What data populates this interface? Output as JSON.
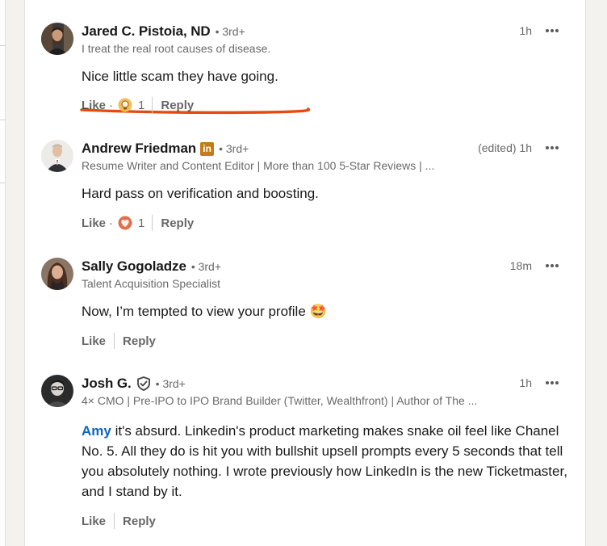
{
  "colors": {
    "accent": "#0a66c2",
    "underline": "#e8490f",
    "linkedin_badge": "#c37d16",
    "meta_text": "#666666"
  },
  "comments": [
    {
      "name": "Jared C. Pistoia, ND",
      "degree": "• 3rd+",
      "headline": "I treat the real root causes of disease.",
      "time": "1h",
      "text": "Nice little scam they have going.",
      "like_label": "Like",
      "reaction_separator": "·",
      "reaction_icon": "insightful-lightbulb-icon",
      "reaction_count": "1",
      "reply_label": "Reply",
      "annotation": "hand-drawn-red-underline"
    },
    {
      "name": "Andrew Friedman",
      "badge": "in",
      "degree": "• 3rd+",
      "headline": "Resume Writer and Content Editor | More than 100 5-Star Reviews | ...",
      "time": "(edited) 1h",
      "text": "Hard pass on verification and boosting.",
      "like_label": "Like",
      "reaction_separator": "·",
      "reaction_icon": "love-heart-icon",
      "reaction_count": "1",
      "reply_label": "Reply"
    },
    {
      "name": "Sally Gogoladze",
      "degree": "• 3rd+",
      "headline": "Talent Acquisition Specialist",
      "time": "18m",
      "text": "Now, I’m tempted to view your profile 🤩",
      "like_label": "Like",
      "reply_label": "Reply"
    },
    {
      "name": "Josh G.",
      "badge_icon": "verified-shield-icon",
      "degree": "• 3rd+",
      "headline": "4× CMO | Pre-IPO to IPO Brand Builder (Twitter, Wealthfront) | Author of The ...",
      "time": "1h",
      "mention": "Amy",
      "text": " it's absurd. Linkedin's product marketing makes snake oil feel like Chanel No. 5. All they do is hit you with bullshit upsell prompts every 5 seconds that tell you absolutely nothing. I wrote previously how LinkedIn is the new Ticketmaster, and I stand by it.",
      "like_label": "Like",
      "reply_label": "Reply"
    }
  ]
}
